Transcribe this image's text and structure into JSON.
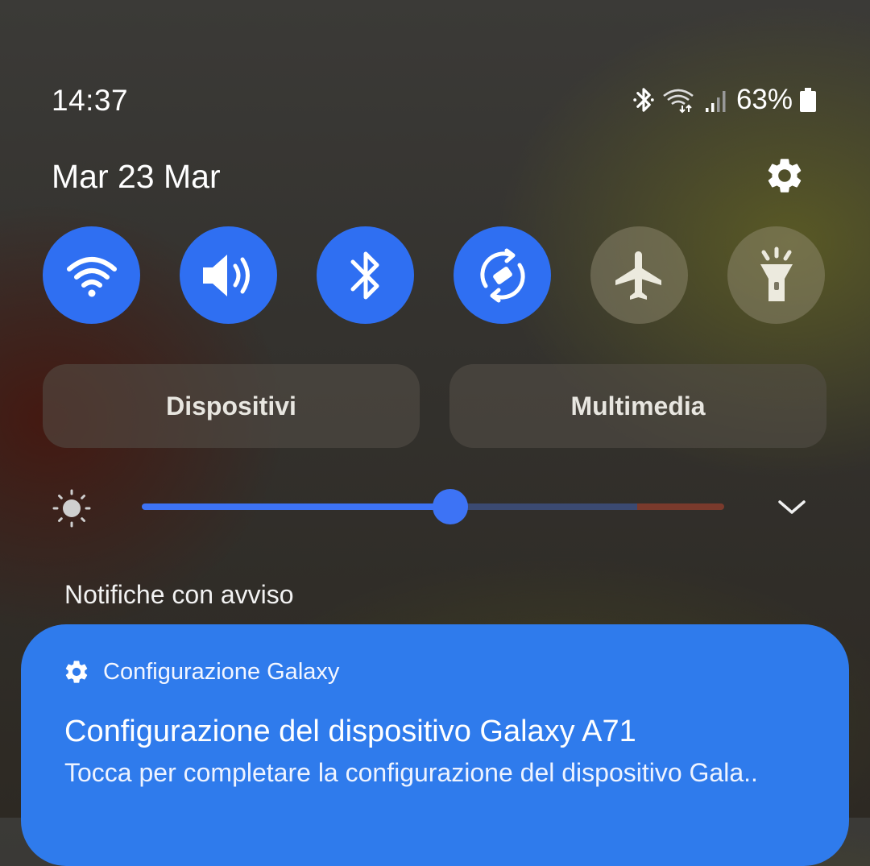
{
  "status_bar": {
    "time": "14:37",
    "battery_percent": "63%",
    "icons": [
      "bluetooth-icon",
      "wifi-data-icon",
      "signal-icon",
      "battery-icon"
    ]
  },
  "panel": {
    "date": "Mar 23 Mar",
    "settings_icon": "gear-icon"
  },
  "quick_toggles": [
    {
      "name": "wifi",
      "icon": "wifi-icon",
      "active": true
    },
    {
      "name": "sound",
      "icon": "speaker-icon",
      "active": true
    },
    {
      "name": "bluetooth",
      "icon": "bluetooth-icon",
      "active": true
    },
    {
      "name": "auto-rotate",
      "icon": "rotate-icon",
      "active": true
    },
    {
      "name": "airplane-mode",
      "icon": "airplane-icon",
      "active": false
    },
    {
      "name": "flashlight",
      "icon": "flashlight-icon",
      "active": false
    }
  ],
  "shortcuts": {
    "devices_label": "Dispositivi",
    "media_label": "Multimedia"
  },
  "brightness": {
    "level": 0.53,
    "icon": "sun-icon",
    "expand_icon": "chevron-down-icon"
  },
  "notifications": {
    "section_title": "Notifiche con avviso",
    "items": [
      {
        "app_icon": "gear-icon",
        "app_name": "Configurazione Galaxy",
        "title": "Configurazione del dispositivo Galaxy A71",
        "body": "Tocca per completare la configurazione del dispositivo Gala.."
      }
    ]
  },
  "colors": {
    "accent_blue": "#2f6ff2",
    "notification_blue": "#2f7bec",
    "inactive_tile": "#7a7662"
  }
}
